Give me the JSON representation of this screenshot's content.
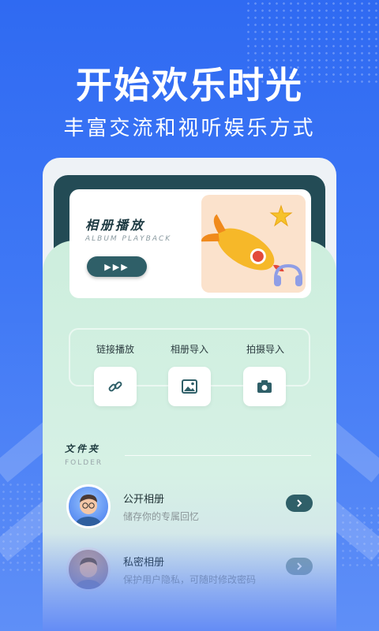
{
  "headline": "开始欢乐时光",
  "subline": "丰富交流和视听娱乐方式",
  "album": {
    "title": "相册播放",
    "subtitle": "ALBUM PLAYBACK",
    "play_label": "▶▶▶"
  },
  "features": [
    {
      "label": "链接播放",
      "icon": "link-icon"
    },
    {
      "label": "相册导入",
      "icon": "image-icon"
    },
    {
      "label": "拍摄导入",
      "icon": "camera-icon"
    }
  ],
  "folder": {
    "title": "文件夹",
    "subtitle": "FOLDER"
  },
  "list": [
    {
      "title": "公开相册",
      "desc": "储存你的专属回忆",
      "icon": "chevron-right-icon"
    },
    {
      "title": "私密相册",
      "desc": "保护用户隐私，可随时修改密码",
      "icon": "chevron-right-icon"
    }
  ],
  "colors": {
    "brand_blue": "#2f6af2",
    "dark_teal": "#234b55",
    "mint": "#cdeedd",
    "peach": "#fbe2cc"
  }
}
